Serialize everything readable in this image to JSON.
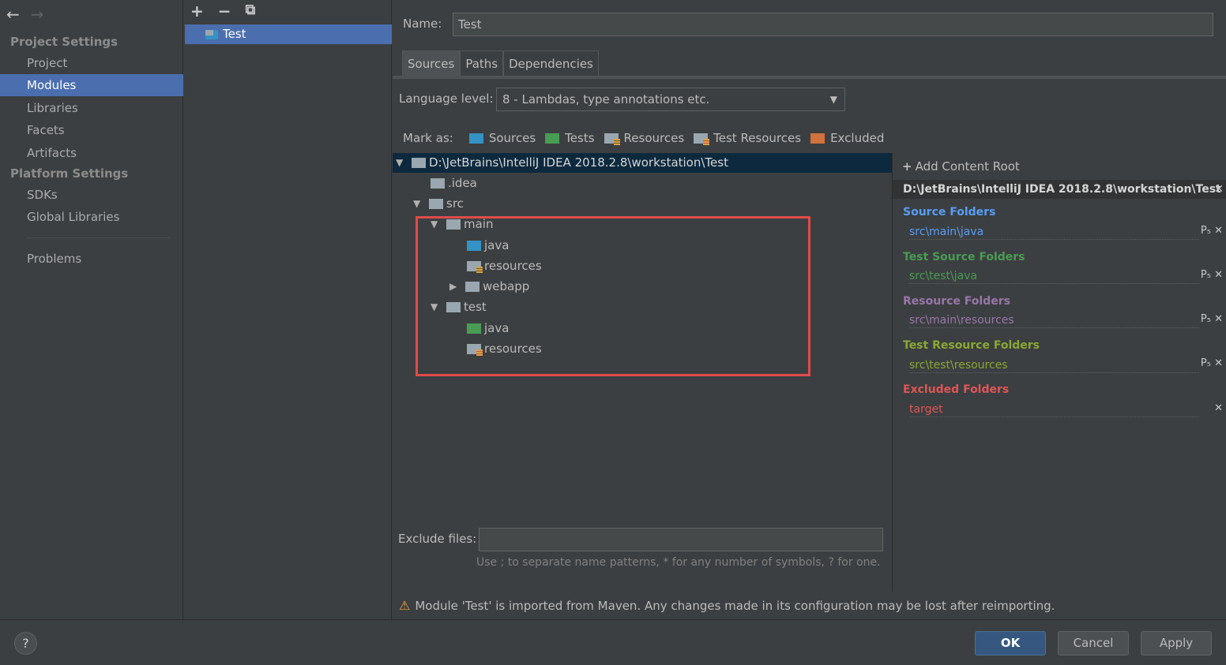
{
  "nav": {
    "back": "←",
    "forward": "→"
  },
  "sidebar": {
    "project_settings": "Project Settings",
    "project_items": [
      "Project",
      "Modules",
      "Libraries",
      "Facets",
      "Artifacts"
    ],
    "platform_settings": "Platform Settings",
    "platform_items": [
      "SDKs",
      "Global Libraries"
    ],
    "problems": "Problems"
  },
  "modules": {
    "toolbar": {
      "add": "+",
      "remove": "−",
      "copy": "⧉"
    },
    "items": [
      "Test"
    ]
  },
  "detail": {
    "name_label": "Name:",
    "name_value": "Test",
    "tabs": [
      "Sources",
      "Paths",
      "Dependencies"
    ],
    "language_level_label": "Language level:",
    "language_level_value": "8 - Lambdas, type annotations etc.",
    "mark_as_label": "Mark as:",
    "mark_as": [
      "Sources",
      "Tests",
      "Resources",
      "Test Resources",
      "Excluded"
    ],
    "tree": {
      "root": "D:\\JetBrains\\IntelliJ IDEA 2018.2.8\\workstation\\Test",
      "nodes": [
        ".idea",
        "src",
        "main",
        "java",
        "resources",
        "webapp",
        "test",
        "java",
        "resources"
      ]
    },
    "add_content_root": "Add Content Root",
    "content_root_path": "D:\\JetBrains\\IntelliJ IDEA 2018.2.8\\workstation\\Test",
    "folder_groups": [
      {
        "title": "Source Folders",
        "path": "src\\main\\java",
        "color": "#589df6"
      },
      {
        "title": "Test Source Folders",
        "path": "src\\test\\java",
        "color": "#499c54"
      },
      {
        "title": "Resource Folders",
        "path": "src\\main\\resources",
        "color": "#9876aa"
      },
      {
        "title": "Test Resource Folders",
        "path": "src\\test\\resources",
        "color": "#8ba833"
      },
      {
        "title": "Excluded Folders",
        "path": "target",
        "color": "#e05555"
      }
    ],
    "exclude_files_label": "Exclude files:",
    "exclude_hint": "Use ; to separate name patterns, * for any number of symbols, ? for one.",
    "warning": "Module 'Test' is imported from Maven. Any changes made in its configuration may be lost after reimporting."
  },
  "buttons": {
    "help": "?",
    "ok": "OK",
    "cancel": "Cancel",
    "apply": "Apply"
  }
}
